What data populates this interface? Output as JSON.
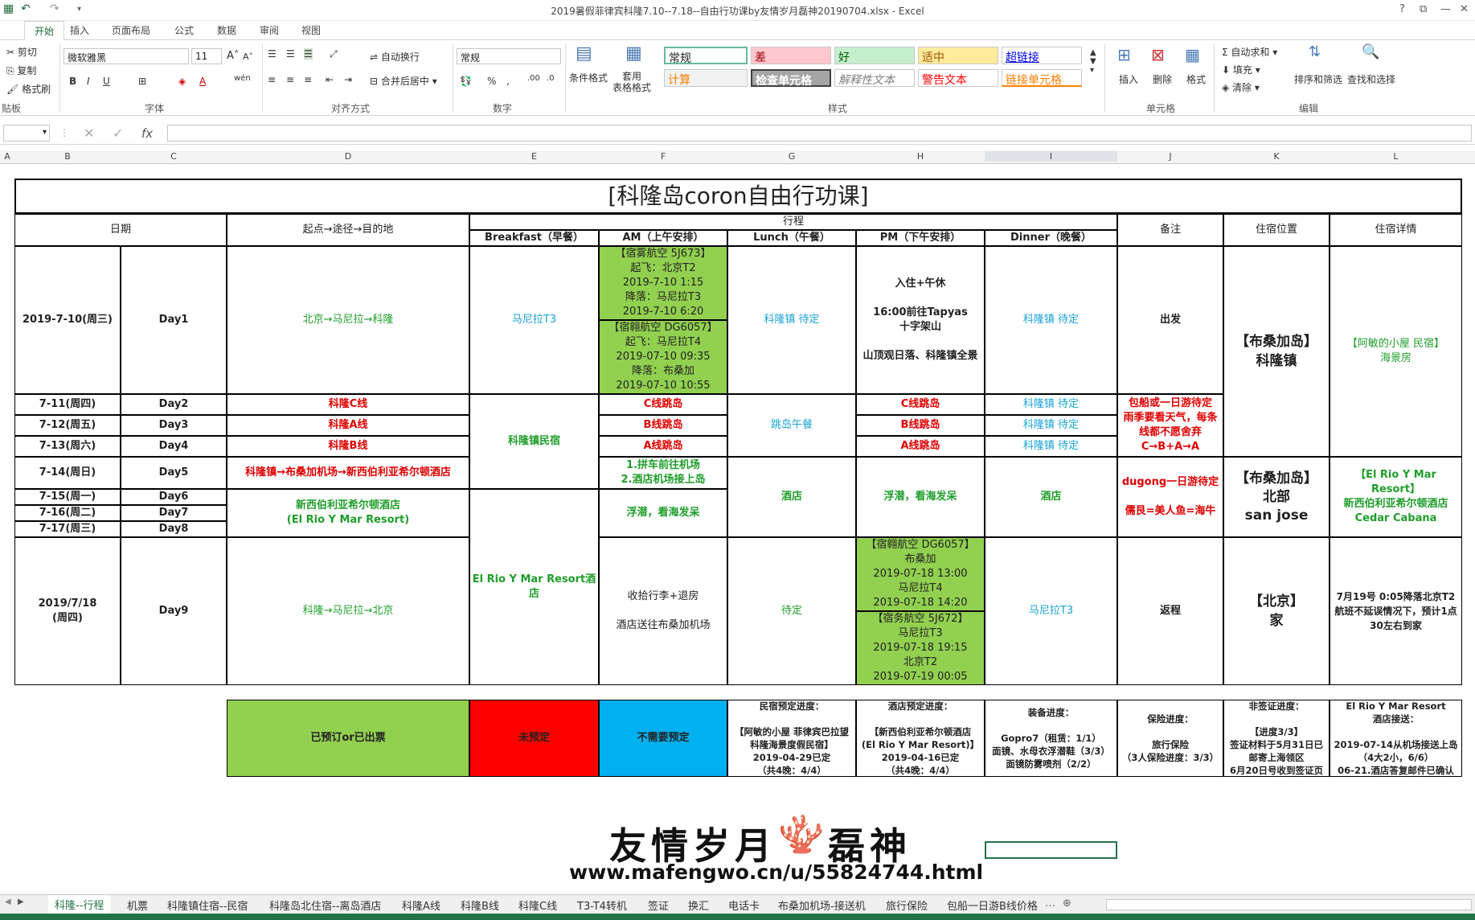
{
  "window": {
    "title": "2019暑假菲律宾科隆7.10--7.18--自由行功课by友情岁月磊神20190704.xlsx - Excel",
    "help": "?",
    "minimize": "—",
    "close": "✕"
  },
  "ribbon_tabs": [
    "开始",
    "插入",
    "页面布局",
    "公式",
    "数据",
    "审阅",
    "视图"
  ],
  "ribbon": {
    "clipboard": {
      "cut": "剪切",
      "copy": "复制",
      "format_painter": "格式刷",
      "label": "贴板"
    },
    "font": {
      "name": "微软雅黑",
      "size": "11",
      "label": "字体"
    },
    "alignment": {
      "wrap": "自动换行",
      "merge": "合并后居中",
      "label": "对齐方式"
    },
    "number": {
      "format": "常规",
      "percent": "%",
      "label": "数字"
    },
    "styles": {
      "conditional": "条件格式",
      "table": "套用\n表格格式",
      "cells": [
        "常规",
        "差",
        "好",
        "适中",
        "超链接",
        "计算",
        "检查单元格",
        "解释性文本",
        "警告文本",
        "链接单元格"
      ],
      "label": "样式"
    },
    "cells_group": {
      "insert": "插入",
      "delete": "删除",
      "format": "格式",
      "label": "单元格"
    },
    "editing": {
      "autosum": "自动求和",
      "fill": "填充",
      "clear": "清除",
      "sort": "排序和筛选",
      "find": "查找和选择",
      "label": "编辑"
    }
  },
  "formula_bar": {
    "fx": "fx",
    "value": ""
  },
  "columns": [
    "A",
    "B",
    "C",
    "D",
    "E",
    "F",
    "G",
    "H",
    "I",
    "J",
    "K",
    "L"
  ],
  "sheet": {
    "title": "[科隆岛coron自由行功课]",
    "headers": {
      "date": "日期",
      "route": "起点→途径→目的地",
      "itinerary": "行程",
      "breakfast": "Breakfast（早餐）",
      "am": "AM（上午安排）",
      "lunch": "Lunch（午餐）",
      "pm": "PM（下午安排）",
      "dinner": "Dinner（晚餐）",
      "note": "备注",
      "stay": "住宿位置",
      "stay_detail": "住宿详情"
    },
    "day1": {
      "date": "2019-7-10(周三)",
      "day": "Day1",
      "route": "北京→马尼拉→科隆",
      "breakfast": "马尼拉T3",
      "am1": "【宿雾航空 5J673】\n起飞：北京T2\n2019-7-10  1:15\n降落：马尼拉T3\n2019-7-10  6:20",
      "am2": "【宿翱航空 DG6057】\n起飞：马尼拉T4\n2019-07-10 09:35\n降落：布桑加\n2019-07-10 10:55",
      "lunch": "科隆镇 待定",
      "pm": "入住+午休\n\n16:00前往Tapyas\n十字架山\n\n山顶观日落、科隆镇全景",
      "dinner": "科隆镇 待定",
      "note": "出发"
    },
    "stay1": {
      "location": "【布桑加岛】\n科隆镇",
      "detail": "【阿敏的小屋 民宿】\n海景房"
    },
    "day2": {
      "date": "7-11(周四)",
      "day": "Day2",
      "route": "科隆C线",
      "am": "C线跳岛",
      "pm": "C线跳岛",
      "dinner": "科隆镇 待定"
    },
    "day3": {
      "date": "7-12(周五)",
      "day": "Day3",
      "route": "科隆A线",
      "am": "B线跳岛",
      "pm": "B线跳岛",
      "dinner": "科隆镇 待定"
    },
    "day4": {
      "date": "7-13(周六)",
      "day": "Day4",
      "route": "科隆B线",
      "am": "A线跳岛",
      "pm": "A线跳岛",
      "dinner": "科隆镇 待定"
    },
    "breakfast_2_4": "科隆镇民宿",
    "lunch_2_4": "跳岛午餐",
    "note_2_4": "包船或一日游待定\n雨季要看天气，每条\n线都不愿舍弃\nC→B+A→A",
    "day5": {
      "date": "7-14(周日)",
      "day": "Day5",
      "route": "科隆镇→布桑加机场→新西伯利亚希尔顿酒店",
      "am": "1.拼车前往机场\n2.酒店机场接上岛"
    },
    "day6": {
      "date": "7-15(周一)",
      "day": "Day6"
    },
    "day7": {
      "date": "7-16(周二)",
      "day": "Day7"
    },
    "day8": {
      "date": "7-17(周三)",
      "day": "Day8"
    },
    "route_6_8": "新西伯利亚希尔顿酒店\n(El Rio Y Mar Resort)",
    "am_6_8": "浮潜，看海发呆",
    "lunch_5_8": "酒店",
    "pm_5_8": "浮潜，看海发呆",
    "dinner_5_8": "酒店",
    "note_5_8": "dugong一日游待定\n\n儒艮=美人鱼=海牛",
    "stay2": {
      "location": "【布桑加岛】\n北部\nsan jose",
      "detail": "【El Rio Y Mar Resort】\n新西伯利亚希尔顿酒店\nCedar Cabana"
    },
    "breakfast_6_9": "El Rio Y Mar Resort酒店",
    "day9": {
      "date": "2019/7/18\n(周四)",
      "day": "Day9",
      "route": "科隆→马尼拉→北京",
      "am": "收拾行李+退房\n\n酒店送往布桑加机场",
      "lunch": "待定",
      "pm1": "【宿翱航空 DG6057】\n布桑加\n2019-07-18 13:00\n马尼拉T4\n2019-07-18 14:20",
      "pm2": "【宿务航空 5J672】\n马尼拉T3\n2019-07-18 19:15\n北京T2\n2019-07-19 00:05",
      "dinner": "马尼拉T3",
      "note": "返程"
    },
    "stay3": {
      "location": "【北京】\n家",
      "detail": "7月19号 0:05降落北京T2\n航班不延误情况下，预计1点\n30左右到家"
    },
    "legend": {
      "booked": "已预订or已出票",
      "not_booked": "未预定",
      "no_need": "不需要预定"
    },
    "progress": {
      "homestay": "民宿预定进度：\n\n【阿敏的小屋 菲律宾巴拉望\n科隆海景度假民宿】\n2019-04-29已定\n（共4晚：4/4）",
      "hotel": "酒店预定进度：\n\n【新西伯利亚希尔顿酒店\n(El Rio Y Mar Resort)】\n2019-04-16已定\n（共4晚：4/4）",
      "gear": "装备进度：\n\nGopro7（租赁：1/1）\n面镜、水母衣浮潜鞋（3/3）\n面镜防雾喷剂（2/2）",
      "insurance": "保险进度：\n\n旅行保险\n（3人保险进度：3/3）",
      "visa": "非签证进度：\n\n【进度3/3】\n签证材料于5月31日已\n邮寄上海领区\n6月20日号收到签证页",
      "transfer": "El Rio Y Mar Resort\n酒店接送：\n\n2019-07-14从机场接送上岛\n（4大2小，6/6）\n06-21.酒店答复邮件已确认"
    },
    "watermark": {
      "name": "友情岁月",
      "name2": "磊神",
      "url": "www.mafengwo.cn/u/55824744.html"
    }
  },
  "sheet_tabs": [
    "科隆--行程",
    "机票",
    "科隆镇住宿--民宿",
    "科隆岛北住宿--离岛酒店",
    "科隆A线",
    "科隆B线",
    "科隆C线",
    "T3-T4转机",
    "签证",
    "换汇",
    "电话卡",
    "布桑加机场-接送机",
    "旅行保险",
    "包船一日游B线价格"
  ],
  "colors": {
    "excel_green": "#217346",
    "booked": "#92d050",
    "not_booked": "#ff0000",
    "no_need": "#00b0f0"
  }
}
